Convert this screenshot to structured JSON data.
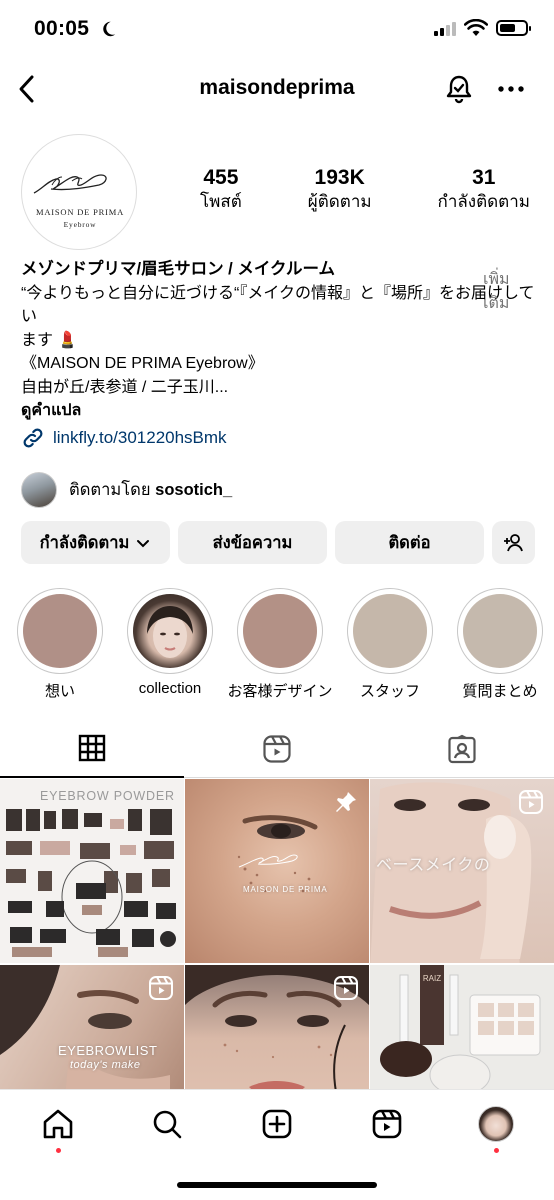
{
  "status_bar": {
    "time": "00:05"
  },
  "header": {
    "username": "maisondeprima"
  },
  "profile": {
    "logo_line1": "MAISON DE PRIMA",
    "logo_line2": "Eyebrow",
    "stats": [
      {
        "value": "455",
        "label": "โพสต์"
      },
      {
        "value": "193K",
        "label": "ผู้ติดตาม"
      },
      {
        "value": "31",
        "label": "กำลังติดตาม"
      }
    ],
    "bio": {
      "name": "メゾンドプリマ/眉毛サロン / メイクルーム",
      "line1": "“今よりもっと自分に近づける“『メイクの情報』と『場所』をお届けしてい",
      "line2": "ます 💄",
      "line3": "《MAISON DE PRIMA Eyebrow》",
      "line4": "自由が丘/表参道 / 二子玉川...",
      "more_label": "เพิ่มเติม",
      "translate_label": "ดูคำแปล"
    },
    "link": "linkfly.to/301220hsBmk",
    "followed_by_prefix": "ติดตามโดย",
    "followed_by_user": "sosotich_"
  },
  "buttons": {
    "following": "กำลังติดตาม",
    "message": "ส่งข้อความ",
    "contact": "ติดต่อ"
  },
  "highlights": [
    {
      "label": "想い",
      "color": "#b09087"
    },
    {
      "label": "collection",
      "color": "#d9c2b8"
    },
    {
      "label": "お客様デザイン",
      "color": "#b39186"
    },
    {
      "label": "スタッフ",
      "color": "#c5b7aa"
    },
    {
      "label": "質問まとめ",
      "color": "#c5b9ad"
    }
  ],
  "grid": {
    "post1_caption": "EYEBROW POWDER",
    "post2_logo": "MAISON DE PRIMA",
    "post3_caption": "ベースメイクの",
    "post4_caption": "EYEBROWLIST",
    "post4_sub": "today's make",
    "post6_brand": "RAIZ"
  },
  "colors": {
    "link": "#00376b",
    "accent_dot": "#ff3040",
    "button_bg": "#efefef"
  }
}
